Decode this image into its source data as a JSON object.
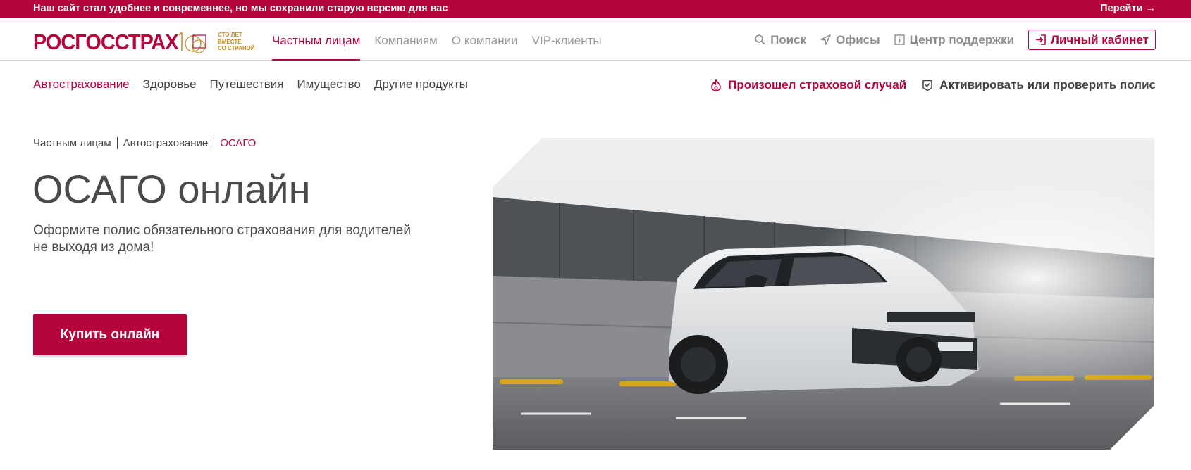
{
  "topbar": {
    "message": "Наш сайт стал удобнее и современнее, но мы сохранили старую версию для вас",
    "link": "Перейти →"
  },
  "header": {
    "logo": "РОСГОССТРАХ",
    "slogan": [
      "СТО ЛЕТ",
      "ВМЕСТЕ",
      "СО СТРАНОЙ"
    ],
    "nav": [
      "Частным лицам",
      "Компаниям",
      "О компании",
      "VIP-клиенты"
    ],
    "search": "Поиск",
    "offices": "Офисы",
    "support": "Центр поддержки",
    "cabinet": "Личный кабинет"
  },
  "subnav": {
    "items": [
      "Автострахование",
      "Здоровье",
      "Путешествия",
      "Имущество",
      "Другие продукты"
    ],
    "insured_event": "Произошел страховой случай",
    "activate": "Активировать или проверить полис"
  },
  "breadcrumb": [
    "Частным лицам",
    "Автострахование",
    "ОСАГО"
  ],
  "hero": {
    "title": "ОСАГО онлайн",
    "subtitle_line1": "Оформите полис обязательного страхования для водителей",
    "subtitle_line2": "не выходя из дома!",
    "button": "Купить онлайн",
    "image": "white-hatchback-car-photo"
  },
  "colors": {
    "brand": "#b5053b",
    "logo_gold": "#c58b1e",
    "text": "#444444",
    "muted": "#9a9a9a"
  }
}
